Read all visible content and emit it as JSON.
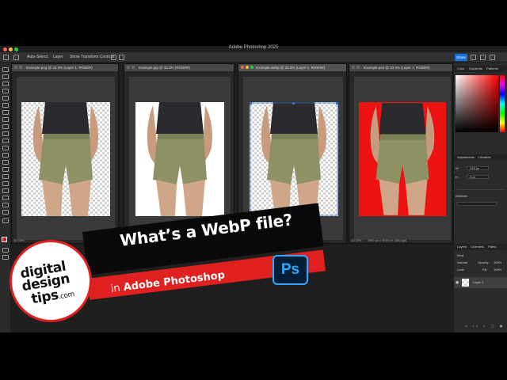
{
  "app": {
    "window_title": "Adobe Photoshop 2025"
  },
  "options_bar": {
    "auto_select_label": "Auto-Select:",
    "auto_select_value": "Layer",
    "transform_controls_label": "Show Transform Controls",
    "share_label": "Share"
  },
  "documents": [
    {
      "tab_title": "Example.png @ 33.3% (Layer 1, RGB/8#)",
      "background": "checker"
    },
    {
      "tab_title": "Example.jpg @ 33.3% (RGB/8#)",
      "background": "white"
    },
    {
      "tab_title": "Example.webp @ 33.3% (Layer 1, RGB/8#)",
      "background": "checker",
      "zoom": "33.33%"
    },
    {
      "tab_title": "Example.psd @ 33.3% (Layer 1, RGB/8#)",
      "background": "red",
      "zoom": "33.33%"
    }
  ],
  "status": {
    "left_zoom": "33.33%",
    "right_zoom": "33.33%",
    "right_size": "2000 px x 3000 px (300 ppi)"
  },
  "right_panel": {
    "top_tabs": [
      "Color",
      "Gradients",
      "Patterns"
    ],
    "mid_tabs": [
      "Adjustments",
      "Libraries"
    ],
    "prop_w": "333 px",
    "prop_h": "0 px",
    "attribute_label": "Attribute",
    "layers_tabs": [
      "Layers",
      "Channels",
      "Paths"
    ],
    "kind_label": "Kind",
    "blend_mode": "Normal",
    "opacity_label": "Opacity:",
    "opacity_value": "100%",
    "lock_label": "Lock:",
    "fill_label": "Fill:",
    "fill_value": "100%",
    "layer_name": "Layer 1"
  },
  "overlay": {
    "headline": "What’s a WebP file?",
    "subline_prefix": "in ",
    "subline_bold": "Adobe Photoshop",
    "ps_logo": "Ps",
    "brand_line1": "digital",
    "brand_line2": "design",
    "brand_line3": "tips",
    "brand_suffix": ".com"
  },
  "colors": {
    "accent": "#1473e6",
    "brand_red": "#e1211f",
    "ps_blue": "#31a8ff",
    "ps_navy": "#001e36"
  }
}
